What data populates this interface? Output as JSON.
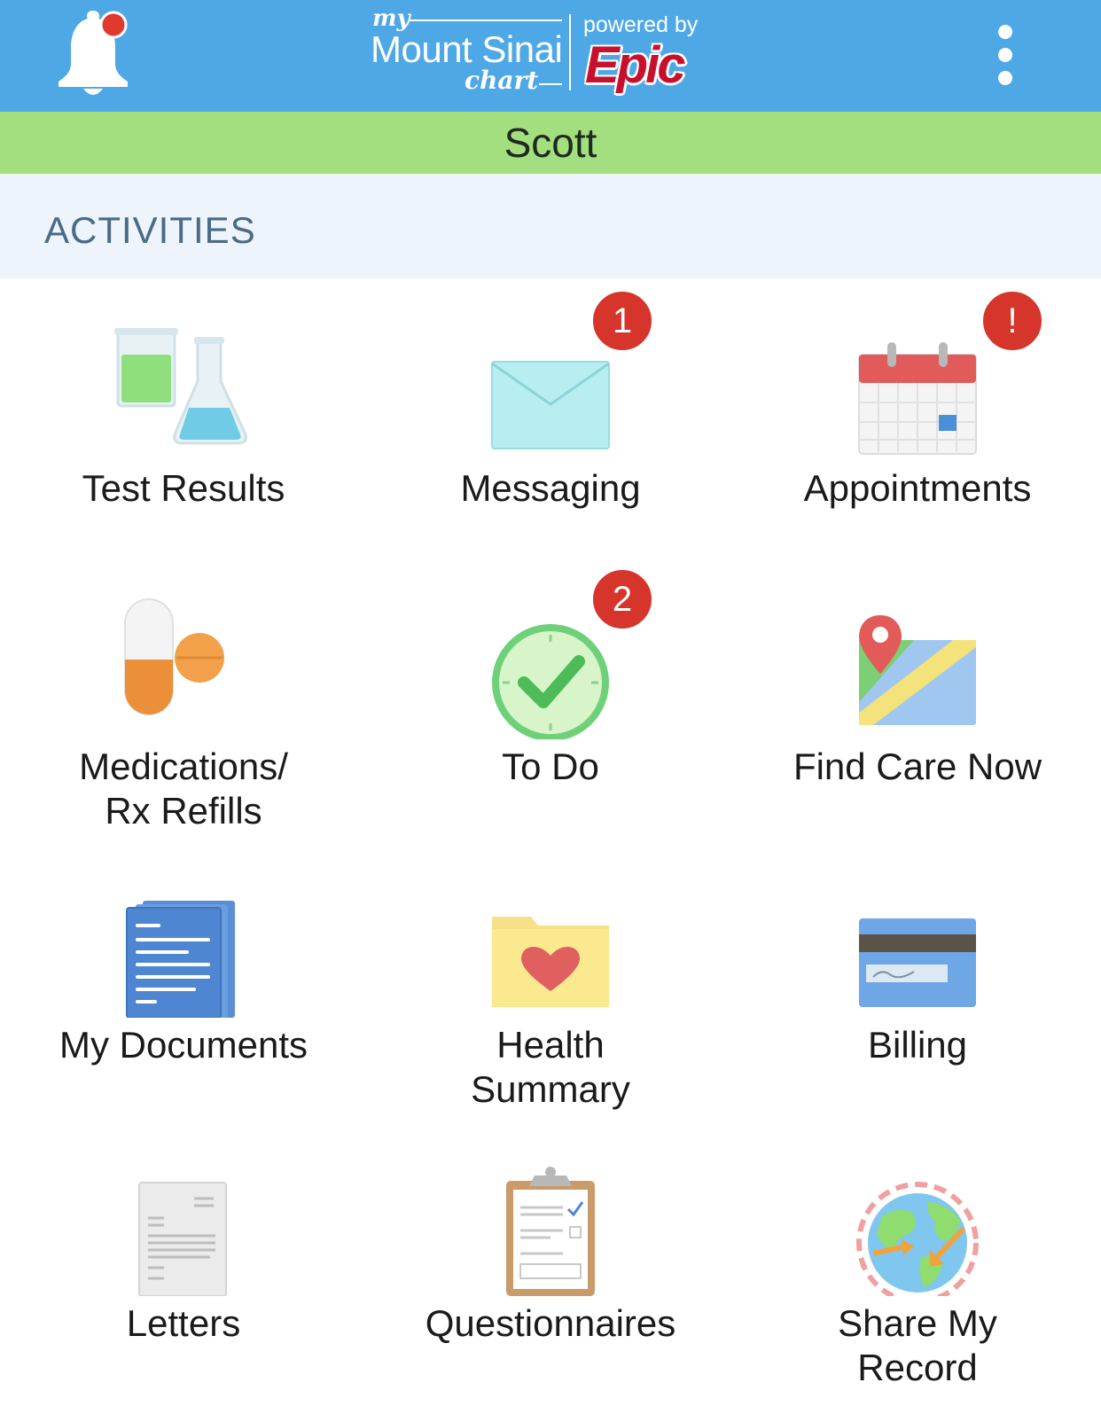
{
  "header": {
    "logo": {
      "my": "my",
      "name": "Mount Sinai",
      "chart": "chart",
      "powered_by": "powered by",
      "epic": "Epic"
    },
    "patient_name": "Scott",
    "notification_icon": "bell-icon",
    "menu_icon": "more-vertical-icon"
  },
  "section": {
    "title": "ACTIVITIES"
  },
  "tiles": [
    {
      "label": "Test Results",
      "icon": "test-tubes-icon"
    },
    {
      "label": "Messaging",
      "icon": "envelope-icon",
      "badge": "1"
    },
    {
      "label": "Appointments",
      "icon": "calendar-icon",
      "badge": "!"
    },
    {
      "label": "Medications/",
      "label2": "Rx Refills",
      "icon": "pills-icon"
    },
    {
      "label": "To Do",
      "icon": "clock-check-icon",
      "badge": "2"
    },
    {
      "label": "Find Care Now",
      "icon": "map-pin-icon"
    },
    {
      "label": "My Documents",
      "icon": "documents-icon"
    },
    {
      "label": "Health",
      "label2": "Summary",
      "icon": "heart-folder-icon"
    },
    {
      "label": "Billing",
      "icon": "credit-card-icon"
    },
    {
      "label": "Letters",
      "icon": "letter-icon"
    },
    {
      "label": "Questionnaires",
      "icon": "clipboard-icon"
    },
    {
      "label": "Share My",
      "label2": "Record",
      "icon": "globe-share-icon"
    }
  ],
  "colors": {
    "header_bg": "#4fa8e6",
    "name_bar_bg": "#a3de7f",
    "section_bg": "#eef4fb",
    "badge_bg": "#d6352b"
  }
}
